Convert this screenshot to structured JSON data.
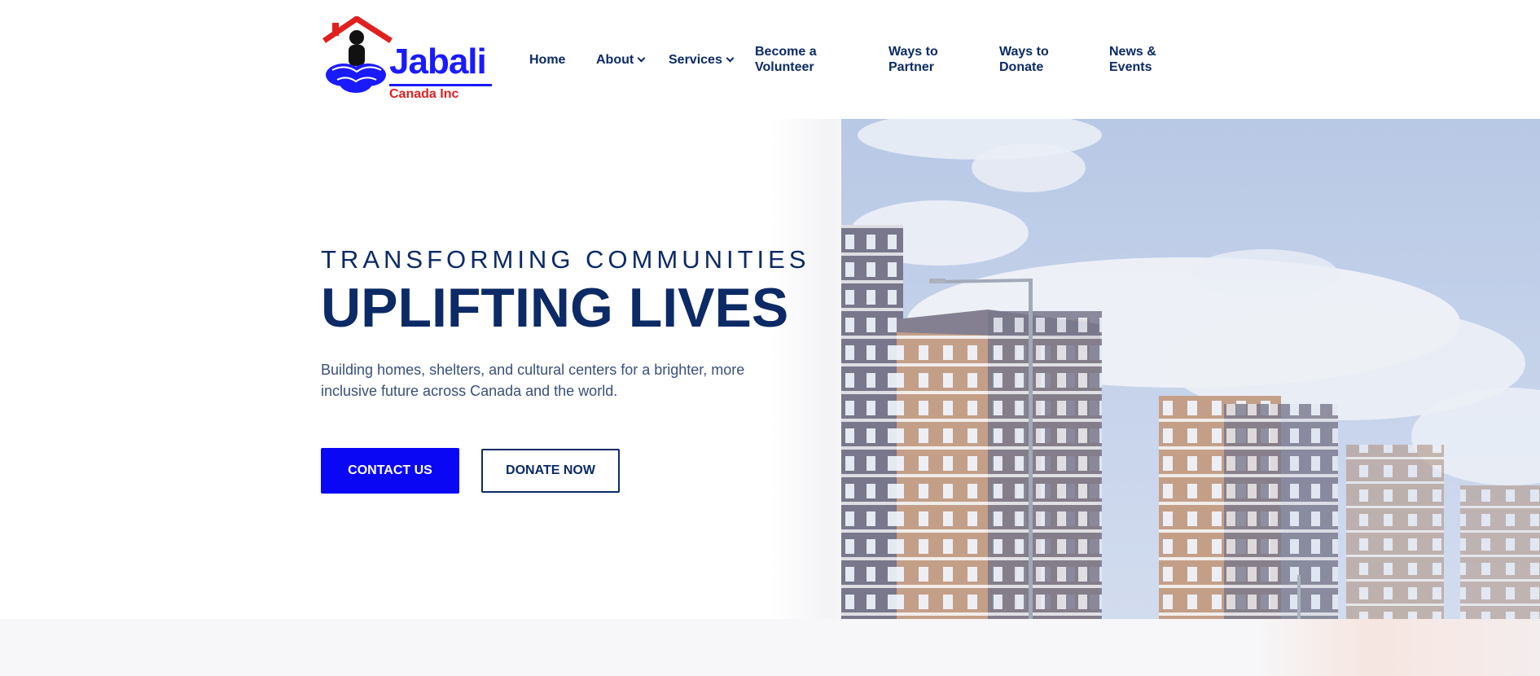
{
  "brand": {
    "name": "Jabali",
    "sub": "Canada Inc",
    "colors": {
      "primary_blue": "#0a07f5",
      "navy": "#0b2a66",
      "logo_red": "#e02020"
    }
  },
  "nav": {
    "items": [
      {
        "label": "Home"
      },
      {
        "label": "About",
        "has_dropdown": true
      },
      {
        "label": "Services",
        "has_dropdown": true
      },
      {
        "label_line1": "Become a",
        "label_line2": "Volunteer"
      },
      {
        "label_line1": "Ways to",
        "label_line2": "Partner"
      },
      {
        "label_line1": "Ways to",
        "label_line2": "Donate"
      },
      {
        "label_line1": "News &",
        "label_line2": "Events"
      }
    ]
  },
  "hero": {
    "kicker": "TRANSFORMING COMMUNITIES",
    "headline": "UPLIFTING LIVES",
    "lede": "Building homes, shelters, and cultural centers for a brighter, more inclusive future across Canada and the world.",
    "primary_cta": "CONTACT US",
    "secondary_cta": "DONATE NOW"
  },
  "icons": {
    "logo": "house-hands-logo",
    "dropdown": "chevron-down-icon"
  }
}
